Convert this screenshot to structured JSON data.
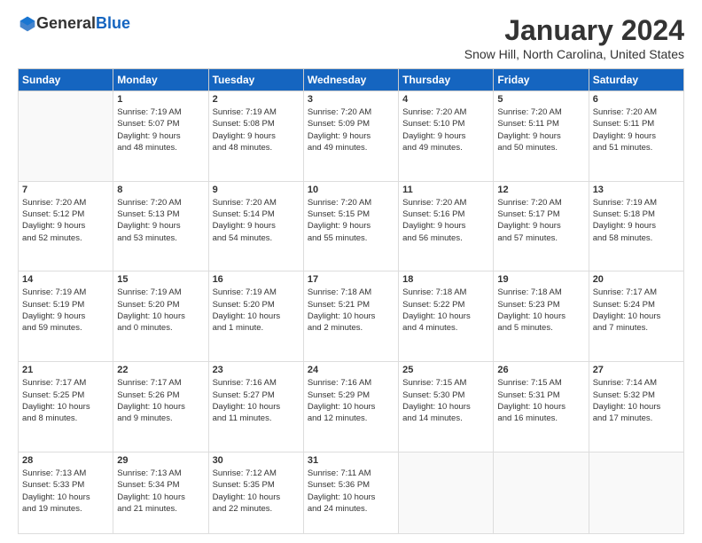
{
  "logo": {
    "general": "General",
    "blue": "Blue"
  },
  "title": "January 2024",
  "location": "Snow Hill, North Carolina, United States",
  "days_header": [
    "Sunday",
    "Monday",
    "Tuesday",
    "Wednesday",
    "Thursday",
    "Friday",
    "Saturday"
  ],
  "weeks": [
    [
      {
        "num": "",
        "info": ""
      },
      {
        "num": "1",
        "info": "Sunrise: 7:19 AM\nSunset: 5:07 PM\nDaylight: 9 hours\nand 48 minutes."
      },
      {
        "num": "2",
        "info": "Sunrise: 7:19 AM\nSunset: 5:08 PM\nDaylight: 9 hours\nand 48 minutes."
      },
      {
        "num": "3",
        "info": "Sunrise: 7:20 AM\nSunset: 5:09 PM\nDaylight: 9 hours\nand 49 minutes."
      },
      {
        "num": "4",
        "info": "Sunrise: 7:20 AM\nSunset: 5:10 PM\nDaylight: 9 hours\nand 49 minutes."
      },
      {
        "num": "5",
        "info": "Sunrise: 7:20 AM\nSunset: 5:11 PM\nDaylight: 9 hours\nand 50 minutes."
      },
      {
        "num": "6",
        "info": "Sunrise: 7:20 AM\nSunset: 5:11 PM\nDaylight: 9 hours\nand 51 minutes."
      }
    ],
    [
      {
        "num": "7",
        "info": "Sunrise: 7:20 AM\nSunset: 5:12 PM\nDaylight: 9 hours\nand 52 minutes."
      },
      {
        "num": "8",
        "info": "Sunrise: 7:20 AM\nSunset: 5:13 PM\nDaylight: 9 hours\nand 53 minutes."
      },
      {
        "num": "9",
        "info": "Sunrise: 7:20 AM\nSunset: 5:14 PM\nDaylight: 9 hours\nand 54 minutes."
      },
      {
        "num": "10",
        "info": "Sunrise: 7:20 AM\nSunset: 5:15 PM\nDaylight: 9 hours\nand 55 minutes."
      },
      {
        "num": "11",
        "info": "Sunrise: 7:20 AM\nSunset: 5:16 PM\nDaylight: 9 hours\nand 56 minutes."
      },
      {
        "num": "12",
        "info": "Sunrise: 7:20 AM\nSunset: 5:17 PM\nDaylight: 9 hours\nand 57 minutes."
      },
      {
        "num": "13",
        "info": "Sunrise: 7:19 AM\nSunset: 5:18 PM\nDaylight: 9 hours\nand 58 minutes."
      }
    ],
    [
      {
        "num": "14",
        "info": "Sunrise: 7:19 AM\nSunset: 5:19 PM\nDaylight: 9 hours\nand 59 minutes."
      },
      {
        "num": "15",
        "info": "Sunrise: 7:19 AM\nSunset: 5:20 PM\nDaylight: 10 hours\nand 0 minutes."
      },
      {
        "num": "16",
        "info": "Sunrise: 7:19 AM\nSunset: 5:20 PM\nDaylight: 10 hours\nand 1 minute."
      },
      {
        "num": "17",
        "info": "Sunrise: 7:18 AM\nSunset: 5:21 PM\nDaylight: 10 hours\nand 2 minutes."
      },
      {
        "num": "18",
        "info": "Sunrise: 7:18 AM\nSunset: 5:22 PM\nDaylight: 10 hours\nand 4 minutes."
      },
      {
        "num": "19",
        "info": "Sunrise: 7:18 AM\nSunset: 5:23 PM\nDaylight: 10 hours\nand 5 minutes."
      },
      {
        "num": "20",
        "info": "Sunrise: 7:17 AM\nSunset: 5:24 PM\nDaylight: 10 hours\nand 7 minutes."
      }
    ],
    [
      {
        "num": "21",
        "info": "Sunrise: 7:17 AM\nSunset: 5:25 PM\nDaylight: 10 hours\nand 8 minutes."
      },
      {
        "num": "22",
        "info": "Sunrise: 7:17 AM\nSunset: 5:26 PM\nDaylight: 10 hours\nand 9 minutes."
      },
      {
        "num": "23",
        "info": "Sunrise: 7:16 AM\nSunset: 5:27 PM\nDaylight: 10 hours\nand 11 minutes."
      },
      {
        "num": "24",
        "info": "Sunrise: 7:16 AM\nSunset: 5:29 PM\nDaylight: 10 hours\nand 12 minutes."
      },
      {
        "num": "25",
        "info": "Sunrise: 7:15 AM\nSunset: 5:30 PM\nDaylight: 10 hours\nand 14 minutes."
      },
      {
        "num": "26",
        "info": "Sunrise: 7:15 AM\nSunset: 5:31 PM\nDaylight: 10 hours\nand 16 minutes."
      },
      {
        "num": "27",
        "info": "Sunrise: 7:14 AM\nSunset: 5:32 PM\nDaylight: 10 hours\nand 17 minutes."
      }
    ],
    [
      {
        "num": "28",
        "info": "Sunrise: 7:13 AM\nSunset: 5:33 PM\nDaylight: 10 hours\nand 19 minutes."
      },
      {
        "num": "29",
        "info": "Sunrise: 7:13 AM\nSunset: 5:34 PM\nDaylight: 10 hours\nand 21 minutes."
      },
      {
        "num": "30",
        "info": "Sunrise: 7:12 AM\nSunset: 5:35 PM\nDaylight: 10 hours\nand 22 minutes."
      },
      {
        "num": "31",
        "info": "Sunrise: 7:11 AM\nSunset: 5:36 PM\nDaylight: 10 hours\nand 24 minutes."
      },
      {
        "num": "",
        "info": ""
      },
      {
        "num": "",
        "info": ""
      },
      {
        "num": "",
        "info": ""
      }
    ]
  ]
}
